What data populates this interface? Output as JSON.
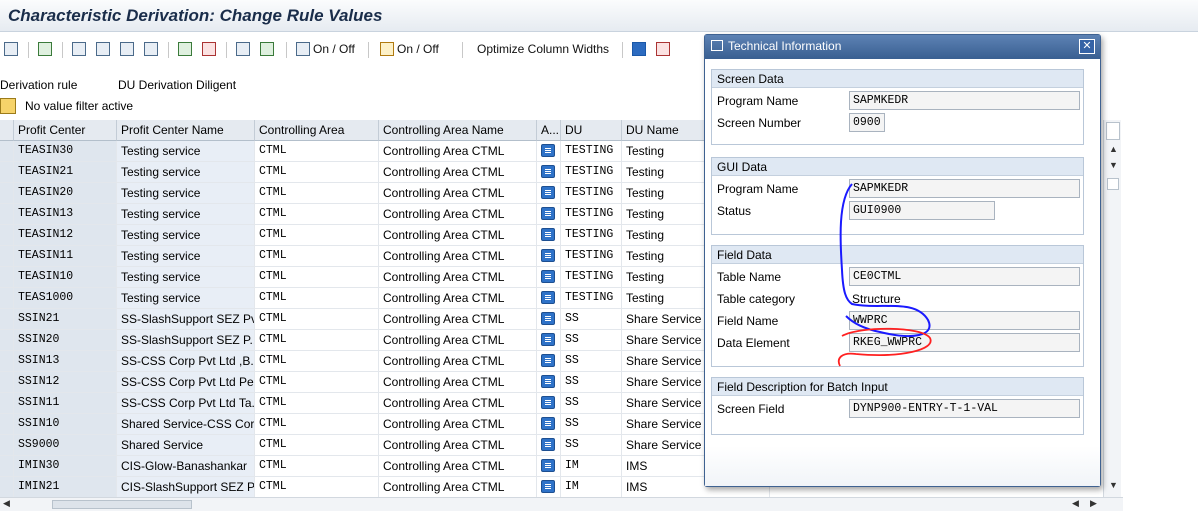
{
  "window": {
    "title": "Characteristic Derivation: Change Rule Values"
  },
  "toolbar": {
    "on_off_1": "On / Off",
    "on_off_2": "On / Off",
    "optimize": "Optimize Column Widths"
  },
  "derivation": {
    "label": "Derivation rule",
    "value": "DU Derivation Diligent"
  },
  "filter": {
    "text": "No value filter active"
  },
  "table": {
    "headers": [
      "Profit Center",
      "Profit Center Name",
      "Controlling Area",
      "Controlling Area Name",
      "A...",
      "DU",
      "DU Name"
    ],
    "rows": [
      [
        "TEASIN30",
        "Testing service",
        "CTML",
        "Controlling Area CTML",
        "TESTING",
        "Testing"
      ],
      [
        "TEASIN21",
        "Testing service",
        "CTML",
        "Controlling Area CTML",
        "TESTING",
        "Testing"
      ],
      [
        "TEASIN20",
        "Testing service",
        "CTML",
        "Controlling Area CTML",
        "TESTING",
        "Testing"
      ],
      [
        "TEASIN13",
        "Testing service",
        "CTML",
        "Controlling Area CTML",
        "TESTING",
        "Testing"
      ],
      [
        "TEASIN12",
        "Testing service",
        "CTML",
        "Controlling Area CTML",
        "TESTING",
        "Testing"
      ],
      [
        "TEASIN11",
        "Testing service",
        "CTML",
        "Controlling Area CTML",
        "TESTING",
        "Testing"
      ],
      [
        "TEASIN10",
        "Testing service",
        "CTML",
        "Controlling Area CTML",
        "TESTING",
        "Testing"
      ],
      [
        "TEAS1000",
        "Testing service",
        "CTML",
        "Controlling Area CTML",
        "TESTING",
        "Testing"
      ],
      [
        "SSIN21",
        "SS-SlashSupport SEZ Pv...",
        "CTML",
        "Controlling Area CTML",
        "SS",
        "Share Service"
      ],
      [
        "SSIN20",
        "SS-SlashSupport SEZ P...",
        "CTML",
        "Controlling Area CTML",
        "SS",
        "Share Service"
      ],
      [
        "SSIN13",
        "SS-CSS Corp Pvt Ltd ,B...",
        "CTML",
        "Controlling Area CTML",
        "SS",
        "Share Service"
      ],
      [
        "SSIN12",
        "SS-CSS Corp Pvt Ltd Pe...",
        "CTML",
        "Controlling Area CTML",
        "SS",
        "Share Service"
      ],
      [
        "SSIN11",
        "SS-CSS Corp Pvt Ltd Ta...",
        "CTML",
        "Controlling Area CTML",
        "SS",
        "Share Service"
      ],
      [
        "SSIN10",
        "Shared Service-CSS Cor...",
        "CTML",
        "Controlling Area CTML",
        "SS",
        "Share Service"
      ],
      [
        "SS9000",
        "Shared Service",
        "CTML",
        "Controlling Area CTML",
        "SS",
        "Share Service"
      ],
      [
        "IMIN30",
        "CIS-Glow-Banashankar",
        "CTML",
        "Controlling Area CTML",
        "IM",
        "IMS"
      ],
      [
        "IMIN21",
        "CIS-SlashSupport SEZ P...",
        "CTML",
        "Controlling Area CTML",
        "IM",
        "IMS"
      ]
    ]
  },
  "dialog": {
    "title": "Technical Information",
    "screen_data": {
      "header": "Screen Data",
      "program_label": "Program Name",
      "program": "SAPMKEDR",
      "screen_label": "Screen Number",
      "screen": "0900"
    },
    "gui_data": {
      "header": "GUI Data",
      "program_label": "Program Name",
      "program": "SAPMKEDR",
      "status_label": "Status",
      "status": "GUI0900"
    },
    "field_data": {
      "header": "Field Data",
      "table_label": "Table Name",
      "table": "CE0CTML",
      "category_label": "Table category",
      "category": "Structure",
      "field_label": "Field Name",
      "field": "WWPRC",
      "element_label": "Data Element",
      "element": "RKEG_WWPRC"
    },
    "batch": {
      "header": "Field Description for Batch Input",
      "screen_field_label": "Screen Field",
      "screen_field": "DYNP900-ENTRY-T-1-VAL"
    }
  },
  "colors": {
    "annotation_blue": "#1a1aff",
    "annotation_red": "#ff2020",
    "header_bg": "#e5eaf0",
    "dialog_title": "#395f91"
  }
}
